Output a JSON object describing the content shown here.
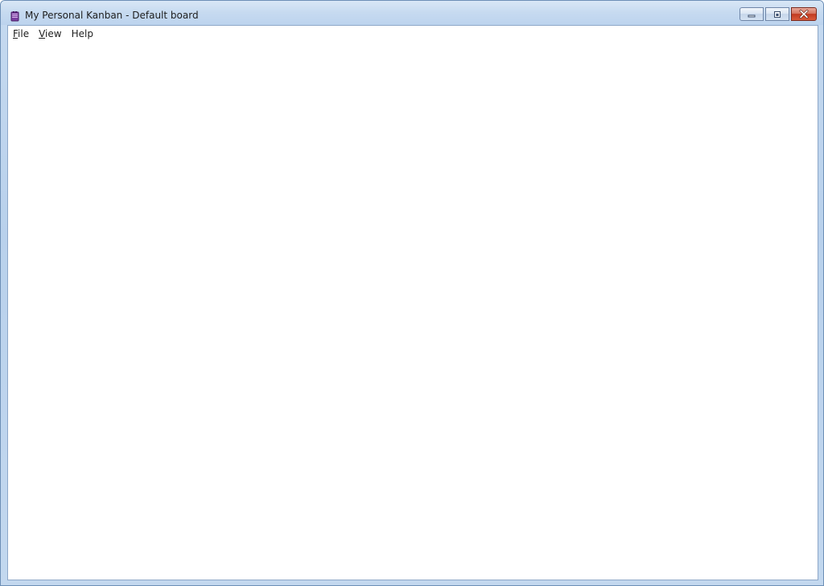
{
  "window": {
    "title": "My Personal Kanban - Default board",
    "app_icon": "kanban-app-icon",
    "caption_buttons": {
      "minimize_icon": "minimize-icon",
      "maximize_icon": "maximize-icon",
      "close_icon": "close-icon"
    }
  },
  "menubar": {
    "items": [
      {
        "accel": "F",
        "rest": "ile"
      },
      {
        "accel": "V",
        "rest": "iew"
      },
      {
        "accel": "",
        "rest": "Help"
      }
    ]
  },
  "colors": {
    "close_button": "#c13a20",
    "frame": "#c6daf0",
    "app_icon": "#7b3fa0"
  }
}
